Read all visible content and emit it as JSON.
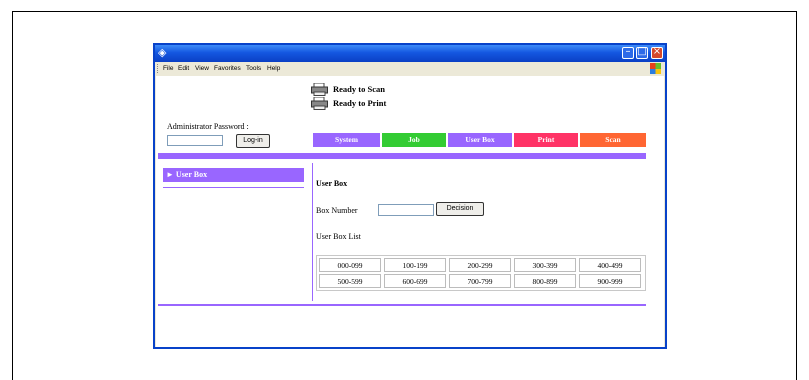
{
  "window": {
    "menu": [
      "File",
      "Edit",
      "View",
      "Favorites",
      "Tools",
      "Help"
    ]
  },
  "status": {
    "scan": "Ready to Scan",
    "print": "Ready to Print"
  },
  "login": {
    "label": "Administrator Password :",
    "button": "Log-in",
    "password_value": ""
  },
  "tabs": [
    {
      "label": "System",
      "color": "#9966ff"
    },
    {
      "label": "Job",
      "color": "#33cc33"
    },
    {
      "label": "User Box",
      "color": "#9966ff"
    },
    {
      "label": "Print",
      "color": "#ff3366"
    },
    {
      "label": "Scan",
      "color": "#ff6633"
    }
  ],
  "sidebar": {
    "items": [
      {
        "label": "► User Box"
      }
    ]
  },
  "main": {
    "title": "User Box",
    "box_number_label": "Box Number",
    "box_number_value": "",
    "decision_button": "Decision",
    "list_label": "User Box List",
    "ranges": [
      [
        "000-099",
        "100-199",
        "200-299",
        "300-399",
        "400-499"
      ],
      [
        "500-599",
        "600-699",
        "700-799",
        "800-899",
        "900-999"
      ]
    ]
  },
  "icons": {
    "app": "app-icon",
    "printer": "printer-icon",
    "windows_logo": "windows-logo-icon"
  }
}
